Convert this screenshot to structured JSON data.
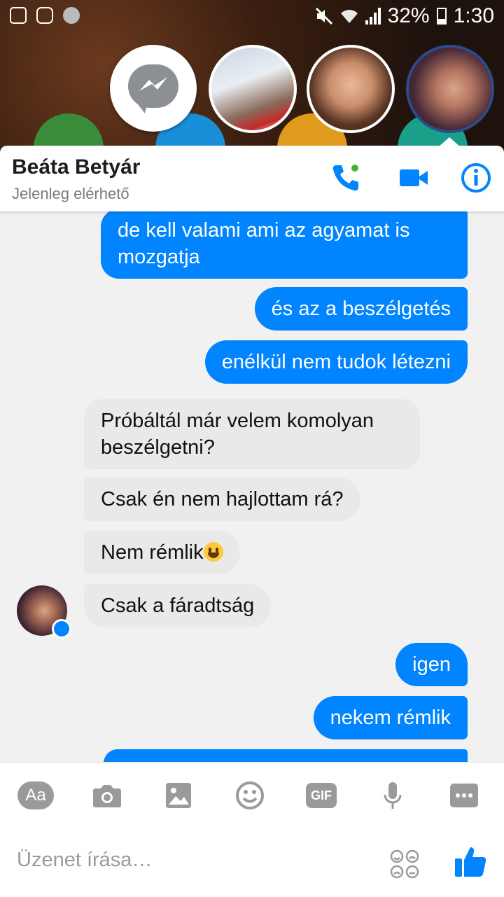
{
  "status_bar": {
    "battery": "32%",
    "time": "1:30"
  },
  "chat_heads": [
    "messenger-head",
    "contact-head-1",
    "contact-head-2",
    "contact-head-3"
  ],
  "header": {
    "name": "Beáta Betyár",
    "presence": "Jelenleg elérhető"
  },
  "messages": [
    {
      "from": "me",
      "text": "de kell valami ami az agyamat is mozgatja"
    },
    {
      "from": "me",
      "text": "és az a beszélgetés"
    },
    {
      "from": "me",
      "text": "enélkül nem tudok létezni"
    },
    {
      "from": "them",
      "text": "Próbáltál már velem komolyan beszélgetni?"
    },
    {
      "from": "them",
      "text": "Csak én nem hajlottam rá?"
    },
    {
      "from": "them",
      "text": "Nem rémlik",
      "emoji": "grinning-face"
    },
    {
      "from": "them",
      "text": "Csak a fáradtság"
    },
    {
      "from": "me",
      "text": "igen"
    },
    {
      "from": "me",
      "text": "nekem rémlik"
    }
  ],
  "toolbar": {
    "aa": "Aa",
    "gif": "GIF"
  },
  "composer": {
    "placeholder": "Üzenet írása…"
  },
  "colors": {
    "accent": "#0084ff",
    "incoming": "#e9e9e9"
  }
}
